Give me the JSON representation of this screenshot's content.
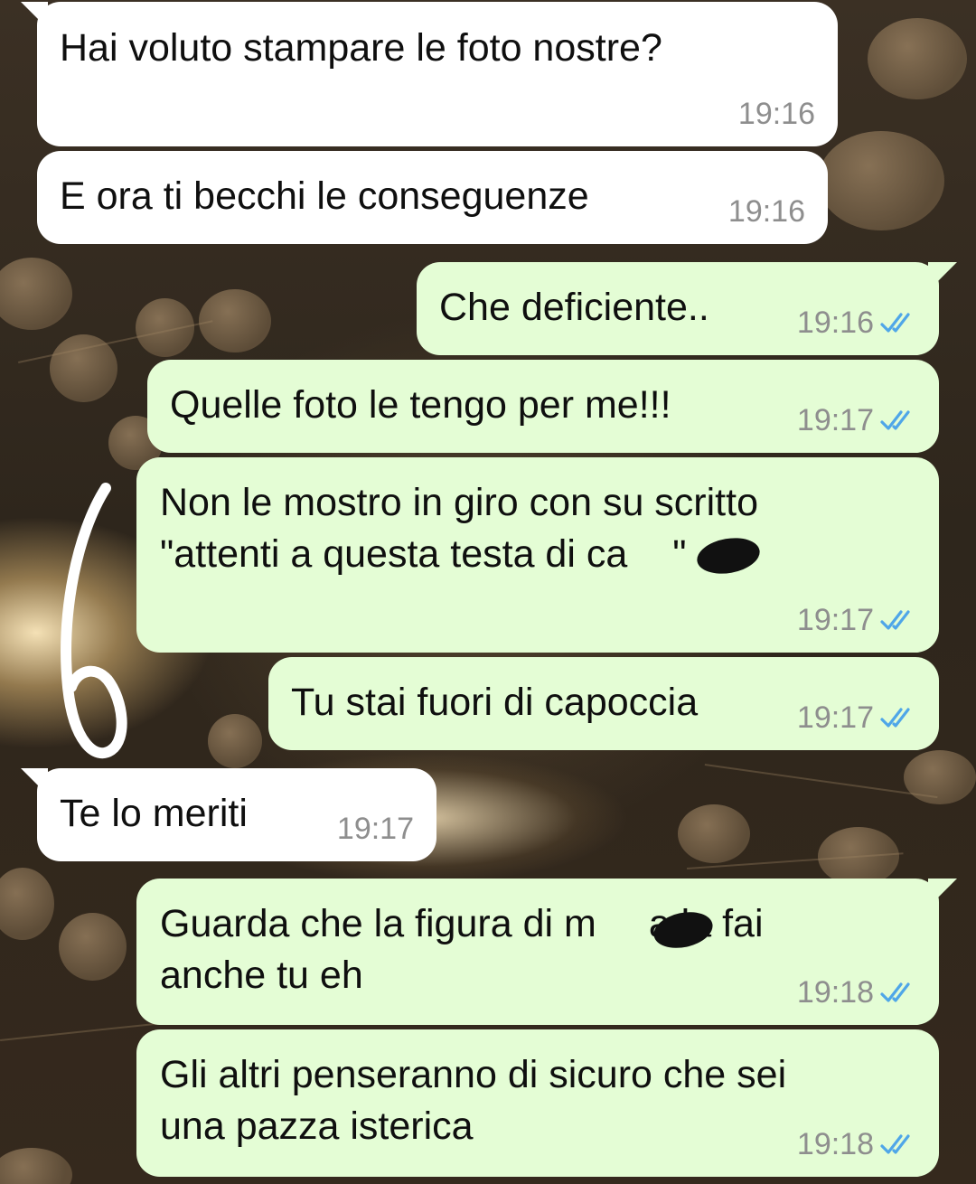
{
  "messages": [
    {
      "direction": "incoming",
      "text": "Hai voluto stampare le foto nostre?",
      "time": "19:16"
    },
    {
      "direction": "incoming",
      "text": "E ora ti becchi le conseguenze",
      "time": "19:16"
    },
    {
      "direction": "outgoing",
      "text": "Che deficiente..",
      "time": "19:16",
      "status": "read"
    },
    {
      "direction": "outgoing",
      "text": "Quelle foto le tengo per me!!!",
      "time": "19:17",
      "status": "read"
    },
    {
      "direction": "outgoing",
      "lines": [
        "Non le mostro in giro con su scritto",
        "\"attenti a questa testa di ca",
        "\""
      ],
      "time": "19:17",
      "status": "read"
    },
    {
      "direction": "outgoing",
      "text": "Tu stai fuori di capoccia",
      "time": "19:17",
      "status": "read"
    },
    {
      "direction": "incoming",
      "text": "Te lo meriti",
      "time": "19:17"
    },
    {
      "direction": "outgoing",
      "lines": [
        "Guarda che la figura di m",
        "a la fai",
        "anche tu eh"
      ],
      "time": "19:18",
      "status": "read"
    },
    {
      "direction": "outgoing",
      "lines": [
        "Gli altri penseranno di sicuro che sei",
        "una pazza isterica"
      ],
      "time": "19:18",
      "status": "read"
    }
  ],
  "colors": {
    "incoming_bubble": "#ffffff",
    "outgoing_bubble": "#e4fdd5",
    "read_ticks": "#4fa6e8",
    "timestamp": "#8e8e8e"
  },
  "icons": [
    "double-check-icon"
  ],
  "annotations": {
    "handwritten_digit": "6"
  }
}
